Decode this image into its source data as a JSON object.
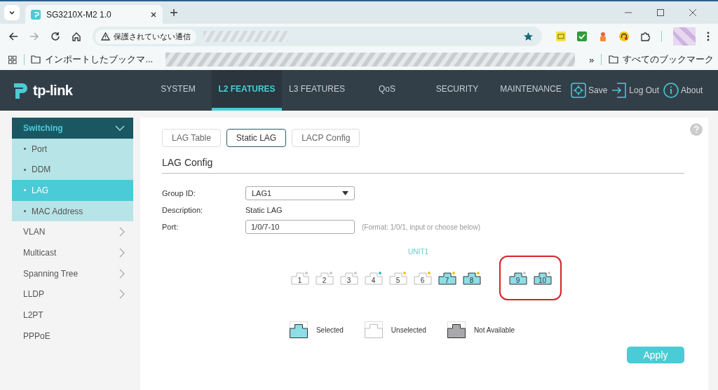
{
  "browser": {
    "tab_title": "SG3210X-M2 1.0",
    "security_label": "保護されていない通信",
    "bookmarks": [
      {
        "label": "インポートしたブックマ..."
      }
    ],
    "all_bookmarks": "すべてのブックマーク",
    "overflow": "»"
  },
  "logo": "tp-link",
  "nav": {
    "items": [
      {
        "label": "SYSTEM",
        "selected": false
      },
      {
        "label": "L2 FEATURES",
        "selected": true
      },
      {
        "label": "L3 FEATURES",
        "selected": false
      },
      {
        "label": "QoS",
        "selected": false
      },
      {
        "label": "SECURITY",
        "selected": false
      },
      {
        "label": "MAINTENANCE",
        "selected": false
      }
    ],
    "actions": [
      {
        "kind": "save",
        "label": "Save"
      },
      {
        "kind": "logout",
        "label": "Log Out"
      },
      {
        "kind": "about",
        "label": "About"
      }
    ]
  },
  "sidebar": {
    "items": [
      {
        "label": "Switching",
        "expanded": true,
        "children": [
          {
            "label": "Port",
            "selected": false
          },
          {
            "label": "DDM",
            "selected": false
          },
          {
            "label": "LAG",
            "selected": true
          },
          {
            "label": "MAC Address",
            "selected": false
          }
        ]
      },
      {
        "label": "VLAN",
        "expanded": false,
        "has_children": true
      },
      {
        "label": "Multicast",
        "expanded": false,
        "has_children": true
      },
      {
        "label": "Spanning Tree",
        "expanded": false,
        "has_children": true
      },
      {
        "label": "LLDP",
        "expanded": false,
        "has_children": true
      },
      {
        "label": "L2PT",
        "expanded": false,
        "has_children": false
      },
      {
        "label": "PPPoE",
        "expanded": false,
        "has_children": false
      }
    ]
  },
  "tabs": [
    {
      "label": "LAG Table",
      "selected": false
    },
    {
      "label": "Static LAG",
      "selected": true
    },
    {
      "label": "LACP Config",
      "selected": false
    }
  ],
  "section_title": "LAG Config",
  "form": {
    "group_id": {
      "label": "Group ID:",
      "value": "LAG1"
    },
    "description": {
      "label": "Description:",
      "value": "Static LAG"
    },
    "port": {
      "label": "Port:",
      "value": "1/0/7-10",
      "hint": "(Format: 1/0/1, input or choose below)"
    }
  },
  "unit": {
    "label": "UNIT1",
    "groups": [
      {
        "highlighted": false,
        "ports": [
          {
            "label": "1",
            "selected": false,
            "color": "#c8c8c8"
          },
          {
            "label": "2",
            "selected": false,
            "color": "#c8c8c8"
          },
          {
            "label": "3",
            "selected": false,
            "color": "#c8c8c8"
          },
          {
            "label": "4",
            "selected": false,
            "color": "#3bb5c4"
          },
          {
            "label": "5",
            "selected": false,
            "color": "#f0c419"
          },
          {
            "label": "6",
            "selected": false,
            "color": "#f0c419"
          },
          {
            "label": "7",
            "selected": true,
            "color": "#f0c419"
          },
          {
            "label": "8",
            "selected": true,
            "color": "#f0c419"
          }
        ]
      },
      {
        "highlighted": true,
        "ports": [
          {
            "label": "9",
            "selected": true,
            "color": "#c8c8c8"
          },
          {
            "label": "10",
            "selected": true,
            "color": "#c8c8c8"
          }
        ]
      }
    ]
  },
  "legend": [
    {
      "kind": "selected",
      "label": "Selected"
    },
    {
      "kind": "unselected",
      "label": "Unselected"
    },
    {
      "kind": "unavailable",
      "label": "Not Available"
    }
  ],
  "apply_button": "Apply"
}
